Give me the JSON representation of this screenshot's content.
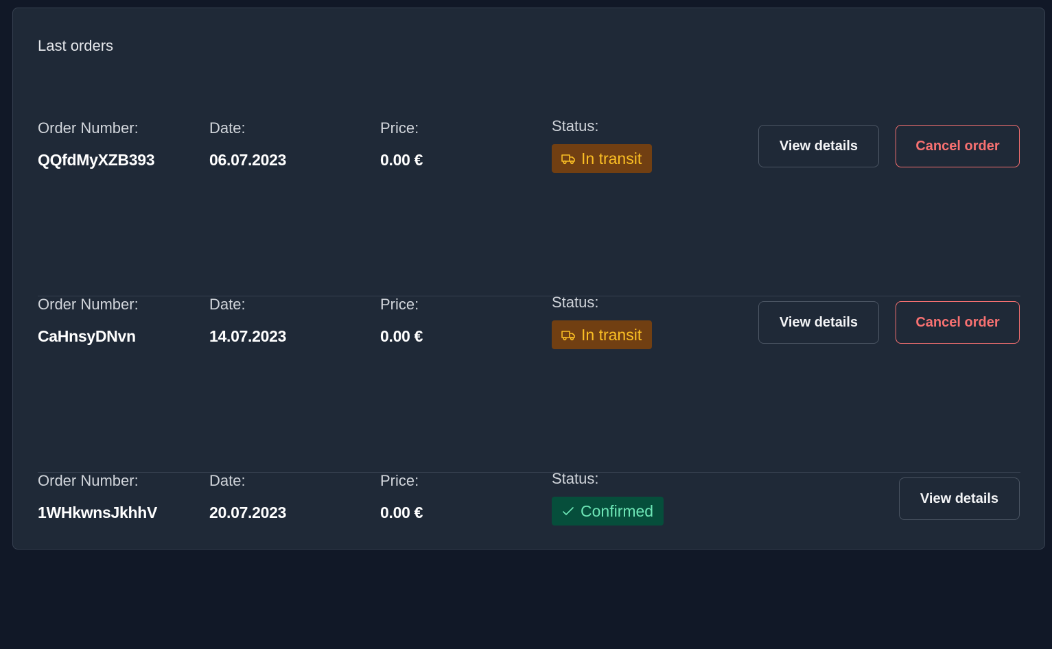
{
  "card": {
    "title": "Last orders"
  },
  "labels": {
    "order_number": "Order Number:",
    "date": "Date:",
    "price": "Price:",
    "status": "Status:"
  },
  "colors": {
    "transit_bg": "#713f12",
    "transit_text": "#fbbf24",
    "confirmed_bg": "#064e3b",
    "confirmed_text": "#6ee7b7",
    "cancel_accent": "#f87171"
  },
  "orders": [
    {
      "number": "QQfdMyXZB393",
      "date": "06.07.2023",
      "price": "0.00 €",
      "status": "In transit",
      "status_icon": "truck-icon",
      "view_label": "View details",
      "cancel_label": "Cancel order"
    },
    {
      "number": "CaHnsyDNvn",
      "date": "14.07.2023",
      "price": "0.00 €",
      "status": "In transit",
      "status_icon": "truck-icon",
      "view_label": "View details",
      "cancel_label": "Cancel order"
    },
    {
      "number": "1WHkwnsJkhhV",
      "date": "20.07.2023",
      "price": "0.00 €",
      "status": "Confirmed",
      "status_icon": "check-icon",
      "view_label": "View details"
    }
  ]
}
